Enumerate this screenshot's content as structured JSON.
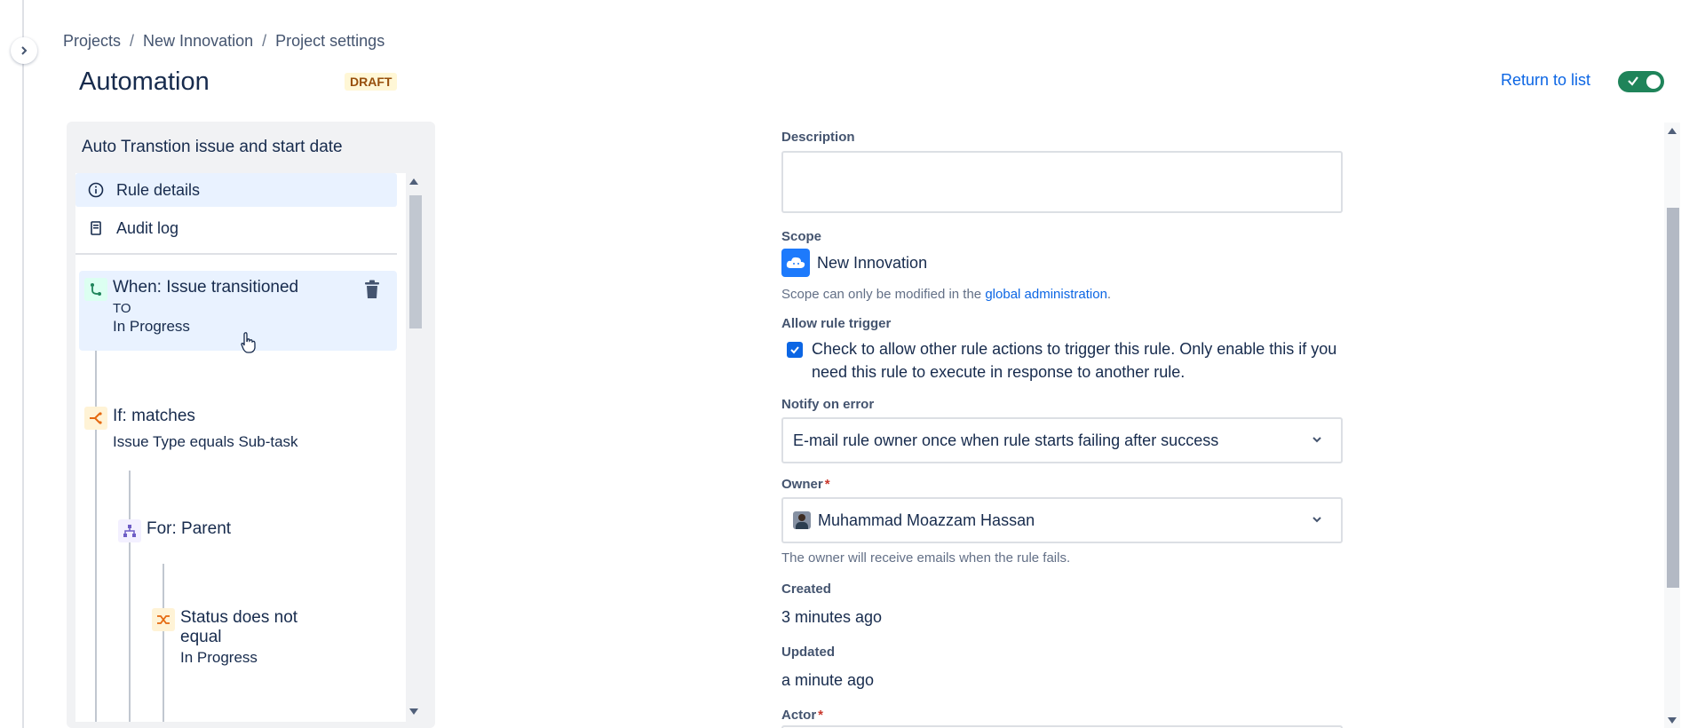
{
  "breadcrumb": [
    "Projects",
    "New Innovation",
    "Project settings"
  ],
  "breadcrumb_separator": "/",
  "header": {
    "title": "Automation",
    "badge": "DRAFT",
    "return_link": "Return to list",
    "rule_enabled": true
  },
  "rule": {
    "name": "Auto Transtion issue and start date",
    "nav": [
      {
        "label": "Rule details",
        "icon": "info-icon",
        "active": true
      },
      {
        "label": "Audit log",
        "icon": "document-icon",
        "active": false
      }
    ],
    "steps": [
      {
        "title": "When: Issue transitioned",
        "line1": "TO",
        "line2": "In Progress",
        "icon": "trigger-icon"
      },
      {
        "title": "If: matches",
        "line1": "Issue Type equals Sub-task",
        "icon": "condition-icon"
      },
      {
        "title": "For: Parent",
        "icon": "branch-icon"
      },
      {
        "title": "Status does not equal",
        "line1": "In Progress",
        "icon": "compare-icon"
      }
    ]
  },
  "form": {
    "description_label": "Description",
    "description_value": "",
    "scope_label": "Scope",
    "scope_value": "New Innovation",
    "scope_help": "Scope can only be modified in the",
    "scope_help_link": "global administration",
    "scope_help_end": ".",
    "allow_trigger_label": "Allow rule trigger",
    "allow_trigger_checked": true,
    "allow_trigger_text": "Check to allow other rule actions to trigger this rule. Only enable this if you need this rule to execute in response to another rule.",
    "notify_label": "Notify on error",
    "notify_value": "E-mail rule owner once when rule starts failing after success",
    "owner_label": "Owner",
    "owner_value": "Muhammad Moazzam Hassan",
    "owner_help": "The owner will receive emails when the rule fails.",
    "created_label": "Created",
    "created_value": "3 minutes ago",
    "updated_label": "Updated",
    "updated_value": "a minute ago",
    "actor_label": "Actor",
    "required_mark": "*"
  },
  "colors": {
    "accent": "#0c66e4",
    "toggle_on": "#1f845a",
    "draft_bg": "#fff7d6",
    "active_item_bg": "#e9f2ff"
  }
}
